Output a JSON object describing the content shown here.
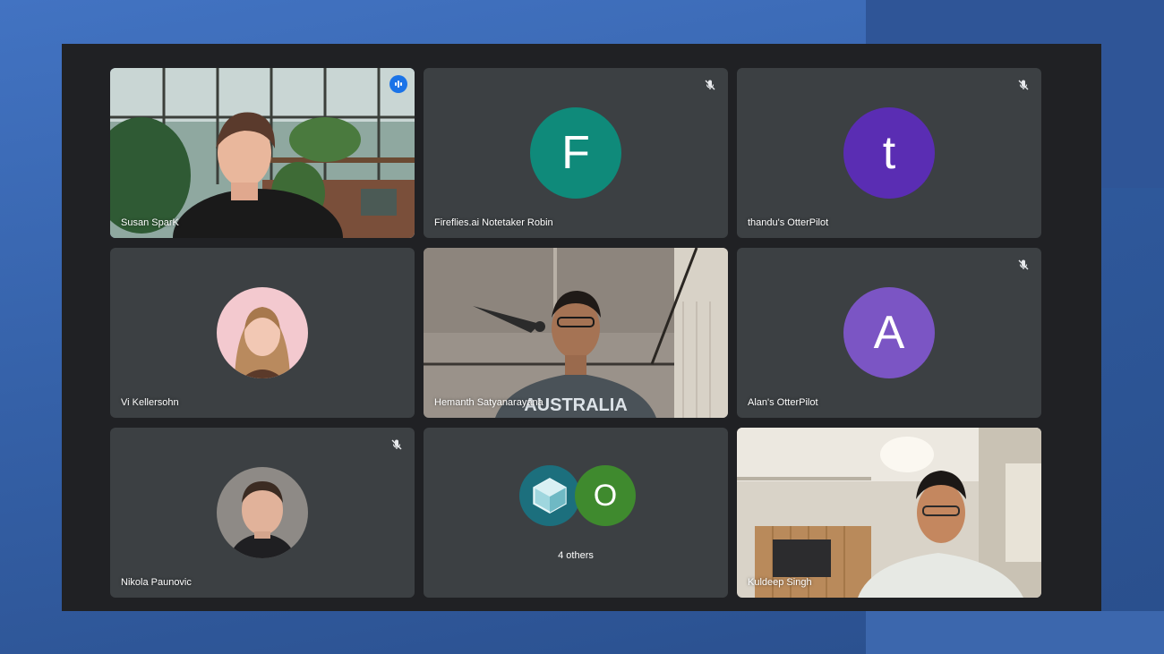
{
  "participants": [
    {
      "name": "Susan SparK",
      "state": "speaking"
    },
    {
      "name": "Fireflies.ai Notetaker Robin",
      "initial": "F",
      "avatar_color": "#0f8a7a",
      "muted": true
    },
    {
      "name": "thandu's OtterPilot",
      "initial": "t",
      "avatar_color": "#5a2db3",
      "muted": true
    },
    {
      "name": "Vi Kellersohn"
    },
    {
      "name": "Hemanth Satyanarayana"
    },
    {
      "name": "Alan's OtterPilot",
      "initial": "A",
      "avatar_color": "#7b55c4",
      "muted": true
    },
    {
      "name": "Nikola Paunovic",
      "muted": true
    },
    {
      "name": "4 others",
      "group_initial": "O",
      "group_colors": [
        "#1c6f7d",
        "#3f8a2e"
      ]
    },
    {
      "name": "Kuldeep Singh"
    }
  ],
  "colors": {
    "tile_bg": "#3c4043",
    "stage_bg": "#202124",
    "active_border": "#8ab4f8",
    "speaking_indicator": "#1a73e8"
  },
  "icons": {
    "muted": "mic-off-icon",
    "speaking": "audio-level-icon"
  }
}
